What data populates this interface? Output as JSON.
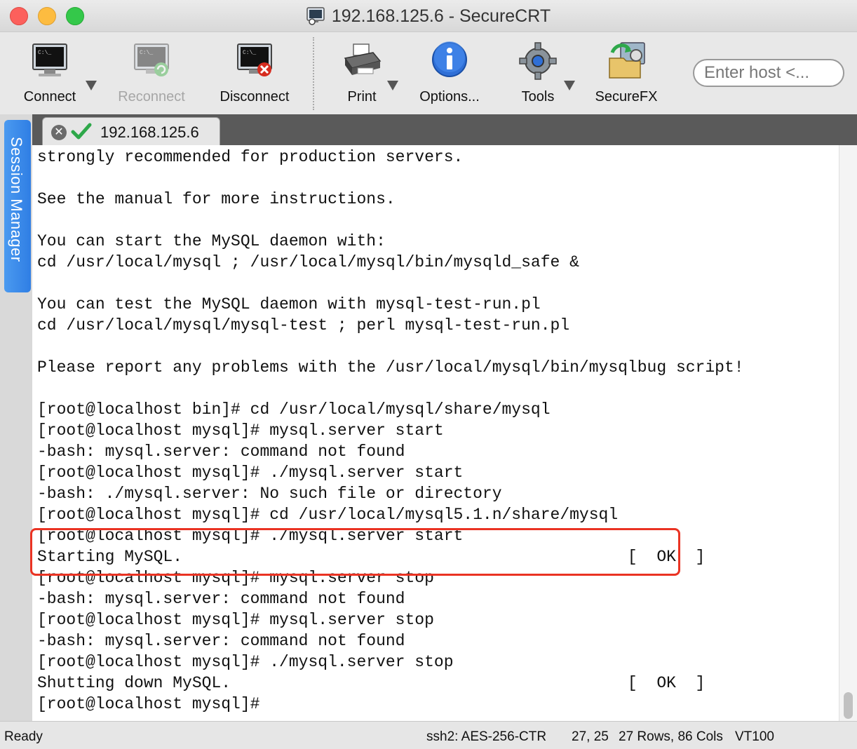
{
  "window": {
    "title": "192.168.125.6 - SecureCRT"
  },
  "toolbar": {
    "connect_label": "Connect",
    "reconnect_label": "Reconnect",
    "disconnect_label": "Disconnect",
    "print_label": "Print",
    "options_label": "Options...",
    "tools_label": "Tools",
    "securefx_label": "SecureFX",
    "host_placeholder": "Enter host <..."
  },
  "sidebar": {
    "session_manager_label": "Session Manager"
  },
  "tabs": [
    {
      "label": "192.168.125.6",
      "status": "connected"
    }
  ],
  "terminal": {
    "lines": [
      "strongly recommended for production servers.",
      "",
      "See the manual for more instructions.",
      "",
      "You can start the MySQL daemon with:",
      "cd /usr/local/mysql ; /usr/local/mysql/bin/mysqld_safe &",
      "",
      "You can test the MySQL daemon with mysql-test-run.pl",
      "cd /usr/local/mysql/mysql-test ; perl mysql-test-run.pl",
      "",
      "Please report any problems with the /usr/local/mysql/bin/mysqlbug script!",
      "",
      "[root@localhost bin]# cd /usr/local/mysql/share/mysql",
      "[root@localhost mysql]# mysql.server start",
      "-bash: mysql.server: command not found",
      "[root@localhost mysql]# ./mysql.server start",
      "-bash: ./mysql.server: No such file or directory",
      "[root@localhost mysql]# cd /usr/local/mysql5.1.n/share/mysql",
      "[root@localhost mysql]# ./mysql.server start",
      "Starting MySQL.                                              [  OK  ]",
      "[root@localhost mysql]# mysql.server stop",
      "-bash: mysql.server: command not found",
      "[root@localhost mysql]# mysql.server stop",
      "-bash: mysql.server: command not found",
      "[root@localhost mysql]# ./mysql.server stop",
      "Shutting down MySQL.                                         [  OK  ]",
      "[root@localhost mysql]#"
    ]
  },
  "statusbar": {
    "state": "Ready",
    "cipher": "ssh2: AES-256-CTR",
    "cursor": "27, 25",
    "size": "27 Rows, 86 Cols",
    "emulation": "VT100"
  },
  "colors": {
    "highlight_box": "#ea3323",
    "session_tab": "#2f7ee4",
    "tab_strip": "#5a5a5a"
  }
}
